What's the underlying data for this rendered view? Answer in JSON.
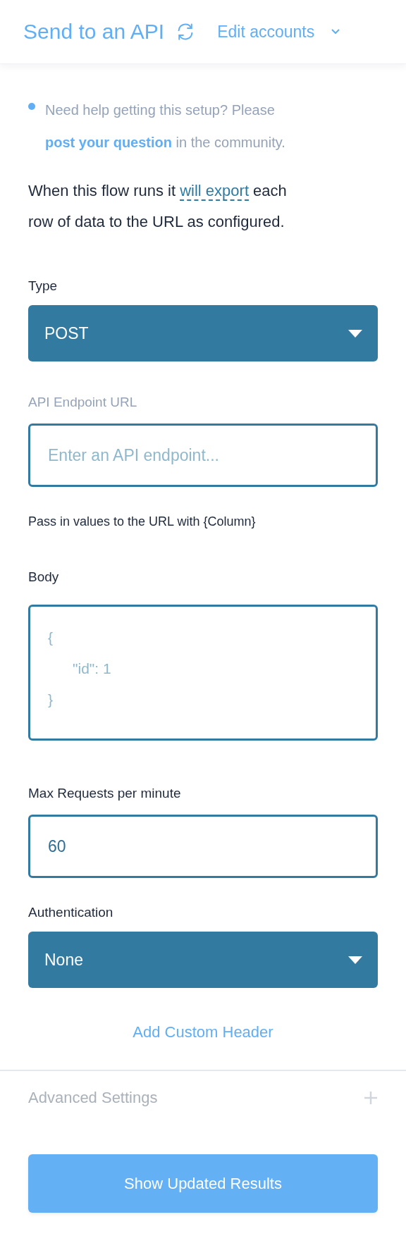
{
  "header": {
    "title": "Send to an API",
    "link": "Edit accounts"
  },
  "help": {
    "text_before": "Need help getting this setup? Please ",
    "link": "post your question",
    "text_after": " in the community."
  },
  "intro": {
    "text_before": "When this flow runs it ",
    "link": "will export",
    "text_after": " each row of data to the URL as configured."
  },
  "fields": [
    {
      "kind": "select",
      "label": "Type",
      "label_muted": false,
      "value": "POST"
    },
    {
      "kind": "input",
      "label": "API Endpoint URL",
      "label_muted": true,
      "placeholder": "Enter an API endpoint...",
      "hint": "Pass in values to the URL with {Column}"
    },
    {
      "kind": "textarea",
      "label": "Body",
      "label_muted": false,
      "placeholder": "{\n\t\"id\": 1\n}"
    },
    {
      "kind": "input",
      "label": "Max Requests per minute",
      "label_muted": false,
      "value": "60"
    },
    {
      "kind": "select",
      "label": "Authentication",
      "label_muted": false,
      "value": "None"
    }
  ],
  "add_header_link": "Add Custom Header",
  "advanced": {
    "label": "Advanced Settings",
    "expanded": false
  },
  "submit_button": "Show Updated Results"
}
